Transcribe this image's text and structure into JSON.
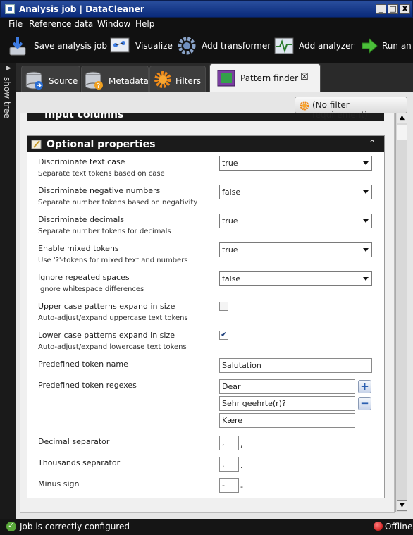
{
  "window": {
    "title": "Analysis job | DataCleaner",
    "controls": [
      "_",
      "□",
      "X"
    ]
  },
  "menu": [
    "File",
    "Reference data",
    "Window",
    "Help"
  ],
  "toolbar": {
    "save": "Save analysis job",
    "visualize": "Visualize",
    "add_transformer": "Add transformer",
    "add_analyzer": "Add analyzer",
    "run": "Run an"
  },
  "showtree": {
    "label": "show tree"
  },
  "tabs": [
    {
      "label": "Source"
    },
    {
      "label": "Metadata"
    },
    {
      "label": "Filters"
    },
    {
      "label": "Pattern finder",
      "close": "☒"
    }
  ],
  "filter_button": "(No filter requirement)",
  "sections": {
    "input_columns": "Input columns",
    "optional": "Optional properties",
    "collapse_glyph": "⌃⌃"
  },
  "properties": [
    {
      "label": "Discriminate text case",
      "desc": "Separate text tokens based on case",
      "type": "combo",
      "value": "true"
    },
    {
      "label": "Discriminate negative numbers",
      "desc": "Separate number tokens based on negativity",
      "type": "combo",
      "value": "false"
    },
    {
      "label": "Discriminate decimals",
      "desc": "Separate number tokens for decimals",
      "type": "combo",
      "value": "true"
    },
    {
      "label": "Enable mixed tokens",
      "desc": "Use '?'-tokens for mixed text and numbers",
      "type": "combo",
      "value": "true"
    },
    {
      "label": "Ignore repeated spaces",
      "desc": "Ignore whitespace differences",
      "type": "combo",
      "value": "false"
    },
    {
      "label": "Upper case patterns expand in size",
      "desc": "Auto-adjust/expand uppercase text tokens",
      "type": "check",
      "checked": false
    },
    {
      "label": "Lower case patterns expand in size",
      "desc": "Auto-adjust/expand lowercase text tokens",
      "type": "check",
      "checked": true
    },
    {
      "label": "Predefined token name",
      "type": "text",
      "value": "Salutation"
    },
    {
      "label": "Predefined token regexes",
      "type": "list",
      "values": [
        "Dear",
        "Sehr geehrte(r)?",
        "Kære"
      ]
    },
    {
      "label": "Decimal separator",
      "type": "char",
      "value": ",",
      "suffix": ","
    },
    {
      "label": "Thousands separator",
      "type": "char",
      "value": ".",
      "suffix": "."
    },
    {
      "label": "Minus sign",
      "type": "char",
      "value": "-",
      "suffix": "-"
    }
  ],
  "buttons": {
    "plus": "+",
    "minus": "−"
  },
  "status": {
    "message": "Job is correctly configured",
    "mode": "Offline"
  }
}
